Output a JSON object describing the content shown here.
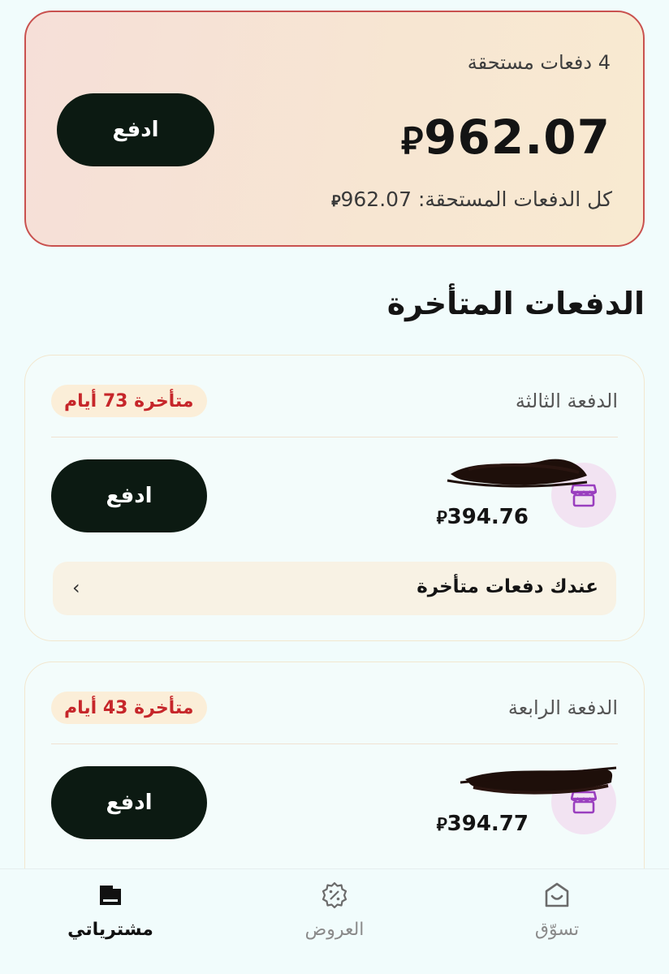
{
  "summary": {
    "due_count": "4 دفعات مستحقة",
    "amount": "962.07",
    "currency_symbol": "⃁",
    "total_label": "كل الدفعات المستحقة:",
    "total_amount": "962.07",
    "pay_label": "ادفع"
  },
  "section": {
    "title": "الدفعات المتأخرة"
  },
  "installments": [
    {
      "label": "الدفعة الثالثة",
      "overdue": "متأخرة 73 أيام",
      "amount": "394.76",
      "pay_label": "ادفع",
      "late_notice": "عندك دفعات متأخرة",
      "chevron": "‹"
    },
    {
      "label": "الدفعة الرابعة",
      "overdue": "متأخرة 43 أيام",
      "amount": "394.77",
      "pay_label": "ادفع"
    }
  ],
  "nav": {
    "shop": "تسوّق",
    "offers": "العروض",
    "purchases": "مشترياتي",
    "active": "purchases"
  },
  "colors": {
    "accent_dark": "#0c1a12",
    "overdue_red": "#c6262a",
    "card_border": "#c9514f",
    "merchant_purple": "#9a3fbf"
  },
  "icons": [
    "merchant-store-icon",
    "shop-bag-icon",
    "offers-percent-icon",
    "purchases-book-icon"
  ]
}
